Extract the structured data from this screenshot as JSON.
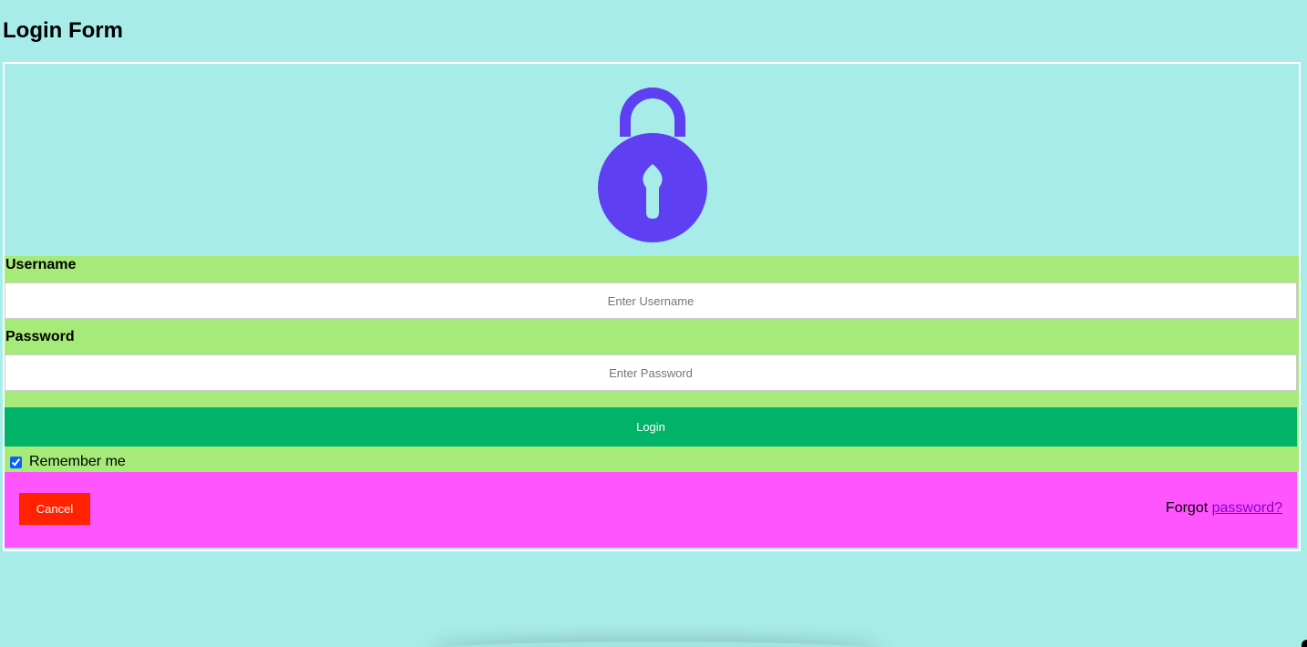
{
  "page": {
    "title": "Login Form"
  },
  "login_form": {
    "icon": "lock-icon",
    "username_label": "Username",
    "username_placeholder": "Enter Username",
    "username_value": "",
    "password_label": "Password",
    "password_placeholder": "Enter Password",
    "password_value": "",
    "login_label": "Login",
    "remember_label": "Remember me",
    "remember_checked": true,
    "cancel_label": "Cancel",
    "forgot_text": "Forgot",
    "forgot_link": "password?"
  },
  "colors": {
    "background": "#a8ecea",
    "form_body": "#a6ea7a",
    "login_button": "#00b368",
    "cancel_button": "#ff2200",
    "footer": "#ff55ff",
    "lock_icon": "#5e3ff2",
    "link": "#8a00c8"
  }
}
